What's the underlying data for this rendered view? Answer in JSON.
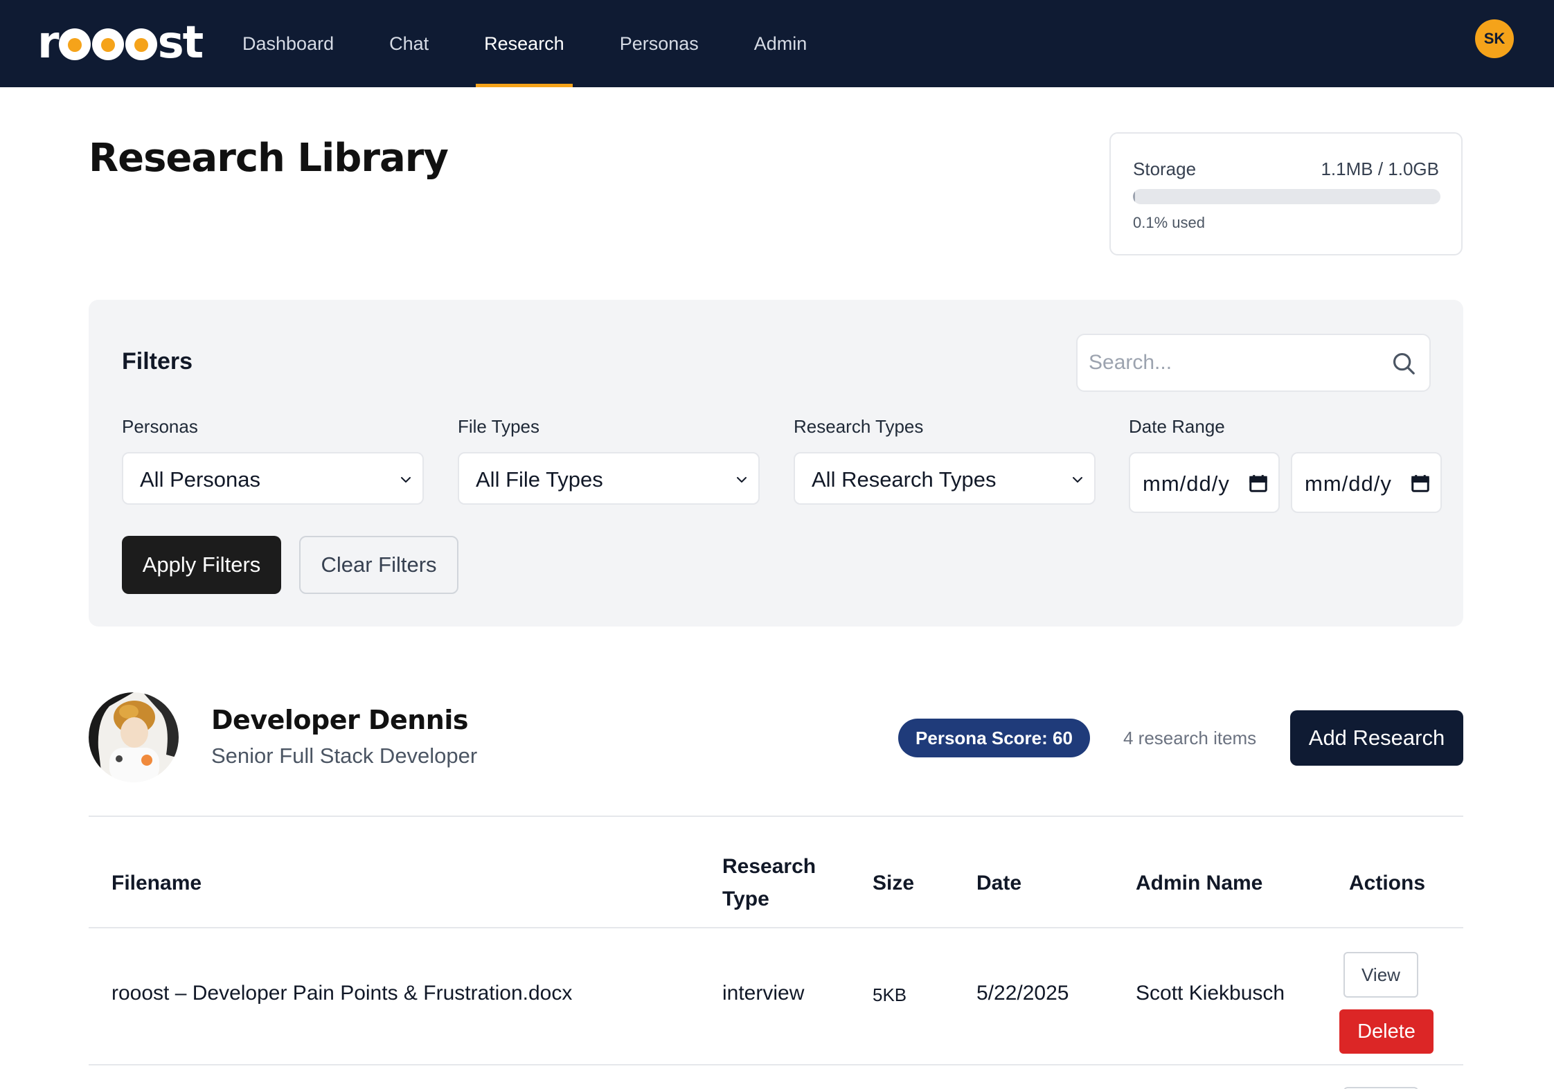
{
  "app": {
    "logo_text": "roooost"
  },
  "nav": {
    "items": [
      {
        "label": "Dashboard"
      },
      {
        "label": "Chat"
      },
      {
        "label": "Research"
      },
      {
        "label": "Personas"
      },
      {
        "label": "Admin"
      }
    ],
    "active": "Research",
    "user_initials": "SK"
  },
  "page": {
    "title": "Research Library"
  },
  "storage": {
    "label": "Storage",
    "amount": "1.1MB / 1.0GB",
    "used_fraction": 0.001,
    "used_label": "0.1% used"
  },
  "filters": {
    "title": "Filters",
    "search_placeholder": "Search...",
    "personas": {
      "label": "Personas",
      "value": "All Personas"
    },
    "file_types": {
      "label": "File Types",
      "value": "All File Types"
    },
    "research_types": {
      "label": "Research Types",
      "value": "All Research Types"
    },
    "date_range": {
      "label": "Date Range",
      "start": "mm/dd/y",
      "end": "mm/dd/y"
    },
    "apply_label": "Apply Filters",
    "clear_label": "Clear Filters"
  },
  "persona": {
    "name": "Developer Dennis",
    "role": "Senior Full Stack Developer",
    "score_label": "Persona Score: 60",
    "research_count": "4 research items",
    "add_label": "Add Research"
  },
  "table": {
    "headers": {
      "filename": "Filename",
      "research_type_1": "Research",
      "research_type_2": "Type",
      "size": "Size",
      "date": "Date",
      "admin_name": "Admin Name",
      "actions": "Actions"
    },
    "rows": [
      {
        "filename": "rooost – Developer Pain Points & Frustration.docx",
        "research_type": "interview",
        "size": "5KB",
        "date": "5/22/2025",
        "admin_name": "Scott Kiekbusch",
        "view_label": "View",
        "delete_label": "Delete"
      }
    ]
  },
  "colors": {
    "nav_bg": "#0f1b33",
    "accent": "#f5a31a",
    "score_badge": "#1f3b7a",
    "delete": "#dc2626",
    "primary_dark": "#1c1c1c"
  },
  "icons": [
    "search-icon",
    "chevron-down-icon",
    "calendar-icon",
    "persona-avatar-photo"
  ]
}
